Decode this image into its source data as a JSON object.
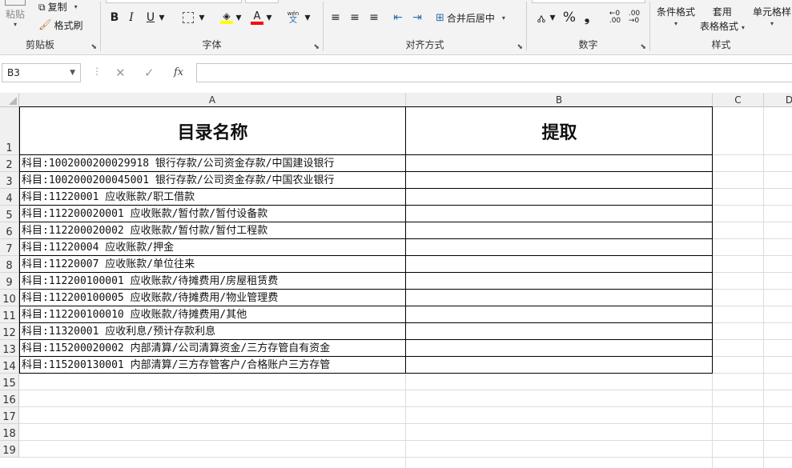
{
  "ribbon": {
    "clipboard": {
      "paste": "粘贴",
      "copy": "复制",
      "format_painter": "格式刷",
      "label": "剪贴板"
    },
    "font": {
      "bold": "B",
      "italic": "I",
      "underline": "U",
      "phonetic": "wén",
      "label": "字体",
      "fill_color": "#ffff00",
      "font_color": "#ff0000"
    },
    "alignment": {
      "merge_center": "合并后居中",
      "label": "对齐方式"
    },
    "number": {
      "percent": "%",
      "comma": "❟",
      "label": "数字"
    },
    "styles": {
      "conditional": "条件格式",
      "table_format_1": "套用",
      "table_format_2": "表格格式",
      "cell_styles": "单元格样",
      "label": "样式"
    }
  },
  "formula_bar": {
    "name_box": "B3",
    "cancel": "✕",
    "enter": "✓",
    "fx": "fx",
    "formula": ""
  },
  "sheet": {
    "columns": [
      "A",
      "B",
      "C",
      "D"
    ],
    "row_numbers": [
      "1",
      "2",
      "3",
      "4",
      "5",
      "6",
      "7",
      "8",
      "9",
      "10",
      "11",
      "12",
      "13",
      "14",
      "15",
      "16",
      "17",
      "18",
      "19"
    ],
    "header": {
      "a1": "目录名称",
      "b1": "提取"
    },
    "rows": [
      "科目:1002000200029918 银行存款/公司资金存款/中国建设银行",
      "科目:1002000200045001 银行存款/公司资金存款/中国农业银行",
      "科目:11220001 应收账款/职工借款",
      "科目:112200020001 应收账款/暂付款/暂付设备款",
      "科目:112200020002 应收账款/暂付款/暂付工程款",
      "科目:11220004 应收账款/押金",
      "科目:11220007 应收账款/单位往来",
      "科目:112200100001 应收账款/待摊费用/房屋租赁费",
      "科目:112200100005 应收账款/待摊费用/物业管理费",
      "科目:112200100010 应收账款/待摊费用/其他",
      "科目:11320001 应收利息/预计存款利息",
      "科目:115200020002 内部清算/公司清算资金/三方存管自有资金",
      "科目:115200130001 内部清算/三方存管客户/合格账户三方存管"
    ]
  }
}
